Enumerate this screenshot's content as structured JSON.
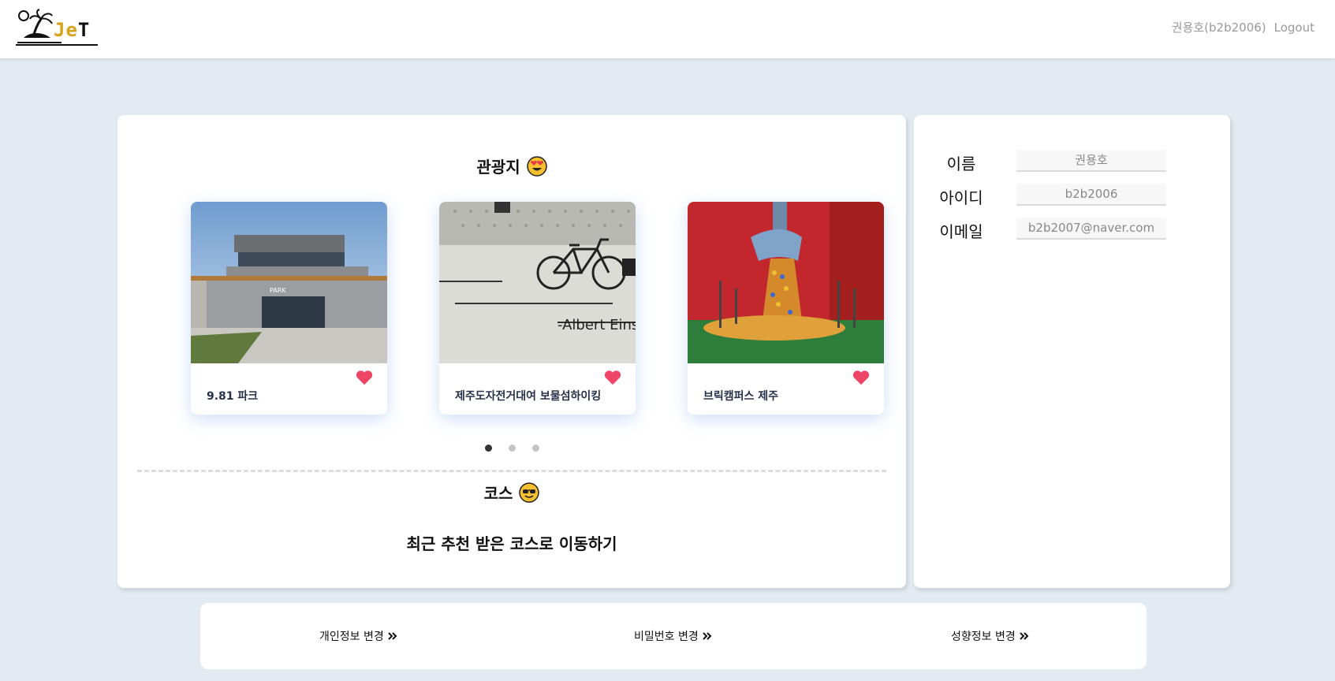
{
  "header": {
    "logo_text_a": "Je",
    "logo_text_b": "T",
    "user_display": "권용호(b2b2006)",
    "logout_label": "Logout"
  },
  "tour": {
    "title": "관광지",
    "places": [
      {
        "name": "9.81 파크",
        "liked": true,
        "image": "modern-building-photo"
      },
      {
        "name": "제주도자전거대여 보물섬하이킹",
        "liked": true,
        "image": "bicycle-wall-photo"
      },
      {
        "name": "브릭캠퍼스 제주",
        "liked": true,
        "image": "lego-faucet-photo"
      }
    ],
    "pagination": {
      "pages": 3,
      "current": 1
    }
  },
  "course": {
    "title": "코스",
    "recent_link_label": "최근 추천 받은 코스로 이동하기"
  },
  "profile": {
    "name_label": "이름",
    "name_value": "권용호",
    "id_label": "아이디",
    "id_value": "b2b2006",
    "email_label": "이메일",
    "email_value": "b2b2007@naver.com"
  },
  "bottom_links": {
    "personal_info": "개인정보 변경",
    "password": "비밀번호 변경",
    "preference": "성향정보 변경"
  },
  "colors": {
    "background": "#e1ebf1",
    "logo_accent": "#d7a11b",
    "heart": "#ee4466",
    "place_name": "#27314a"
  }
}
